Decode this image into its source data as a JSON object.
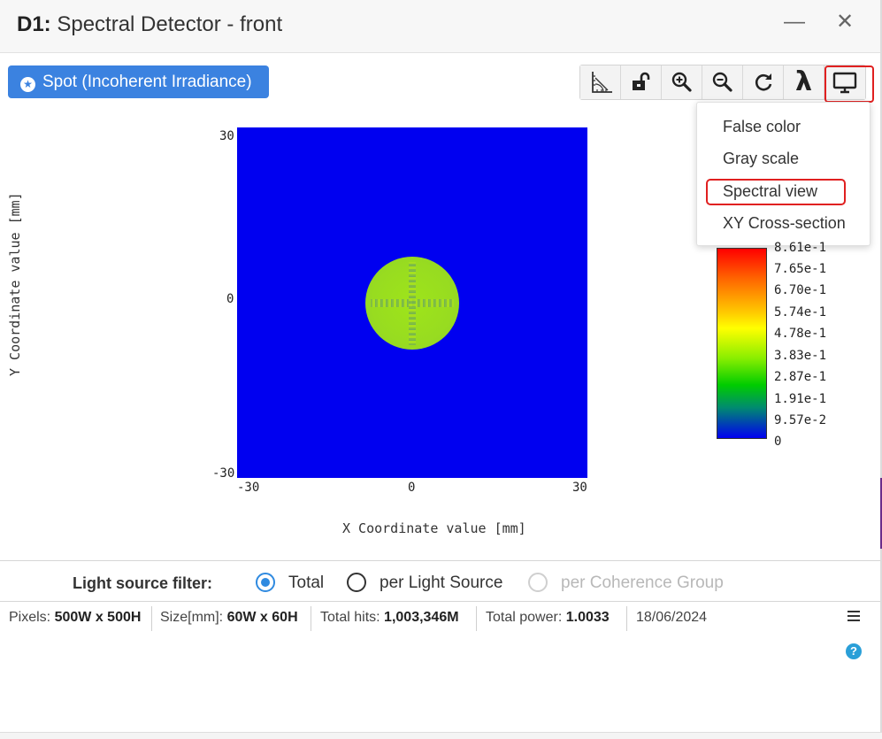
{
  "window": {
    "title_prefix": "D1:",
    "title_rest": " Spectral Detector - front",
    "minimize_glyph": "—",
    "close_glyph": "✕"
  },
  "spot_button": {
    "label": "Spot (Incoherent Irradiance)",
    "icon": "star-circle-icon"
  },
  "toolbar": {
    "buttons": [
      {
        "name": "ruler-angle-icon"
      },
      {
        "name": "unlock-icon"
      },
      {
        "name": "zoom-in-icon"
      },
      {
        "name": "zoom-out-icon"
      },
      {
        "name": "refresh-icon"
      },
      {
        "name": "lambda-icon",
        "glyph": "λ"
      },
      {
        "name": "monitor-icon",
        "active": true
      }
    ]
  },
  "display_menu": {
    "items": [
      "False color",
      "Gray scale",
      "Spectral view",
      "XY Cross-section"
    ],
    "highlighted": "Spectral view"
  },
  "plot": {
    "xlabel": "X Coordinate value [mm]",
    "ylabel": "Y Coordinate value [mm]",
    "x_ticks": [
      "-30",
      "0",
      "30"
    ],
    "y_ticks": [
      "30",
      "0",
      "-30"
    ]
  },
  "colorbar": {
    "labels": [
      "8.61e-1",
      "7.65e-1",
      "6.70e-1",
      "5.74e-1",
      "4.78e-1",
      "3.83e-1",
      "2.87e-1",
      "1.91e-1",
      "9.57e-2",
      "0"
    ]
  },
  "filter": {
    "label": "Light source filter:",
    "options": [
      {
        "label": "Total",
        "state": "selected"
      },
      {
        "label": "per Light Source",
        "state": "unselected"
      },
      {
        "label": "per Coherence Group",
        "state": "disabled"
      }
    ]
  },
  "status": {
    "pixels_label": "Pixels:",
    "pixels_value": "500W x 500H",
    "size_label": "Size[mm]:",
    "size_value": "60W x 60H",
    "hits_label": "Total hits:",
    "hits_value": "1,003,346M",
    "power_label": "Total power:",
    "power_value": "1.0033",
    "date": "18/06/2024"
  },
  "colors": {
    "accent": "#3b82e0",
    "highlight_border": "#e02020",
    "plot_background": "#0000f0",
    "spot": "#9ee41a"
  }
}
